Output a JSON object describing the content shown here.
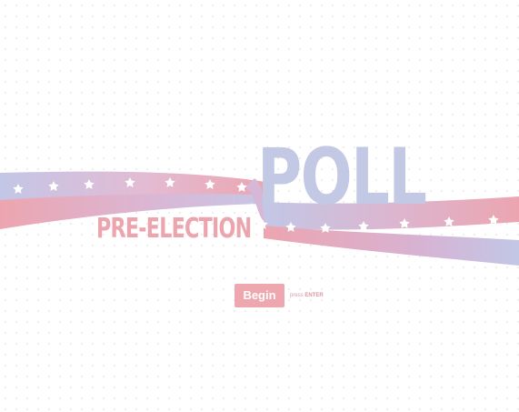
{
  "title": {
    "main": "POLL",
    "sub": "PRE-ELECTION"
  },
  "actions": {
    "begin_label": "Begin",
    "hint_press": "press",
    "hint_key": "ENTER"
  },
  "colors": {
    "ribbon_blue": "#c2c7e6",
    "ribbon_pink": "#eca5b0",
    "title_main": "#c3c9e4",
    "title_sub": "#eca4ae",
    "button_bg": "#eea7ae",
    "star": "#ffffff"
  },
  "icons": {
    "decorative_shape": "star"
  }
}
